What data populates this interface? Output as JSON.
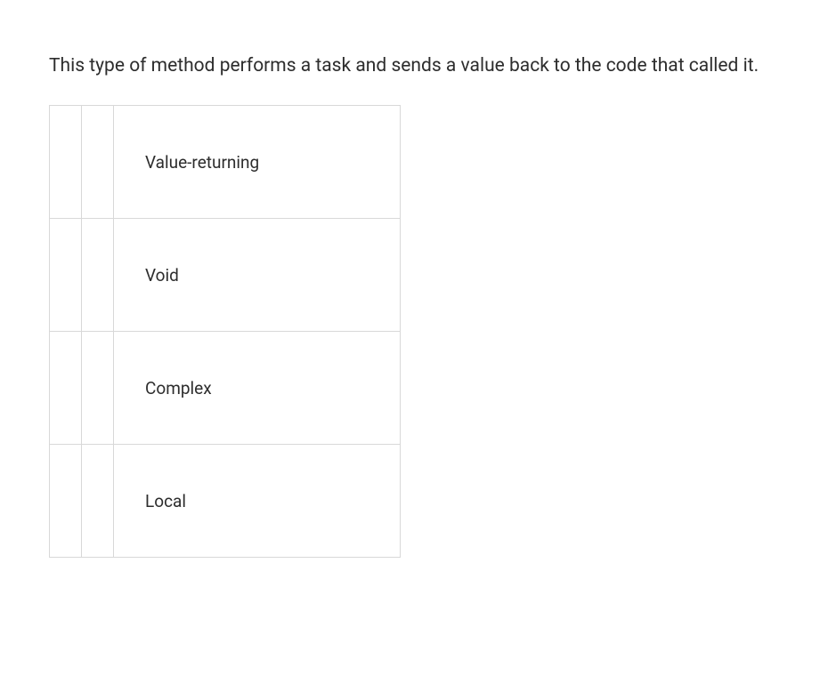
{
  "question": {
    "prompt": "This type of method performs a task and sends a value back to the code that called it."
  },
  "options": [
    {
      "label": "Value-returning"
    },
    {
      "label": "Void"
    },
    {
      "label": "Complex"
    },
    {
      "label": "Local"
    }
  ]
}
